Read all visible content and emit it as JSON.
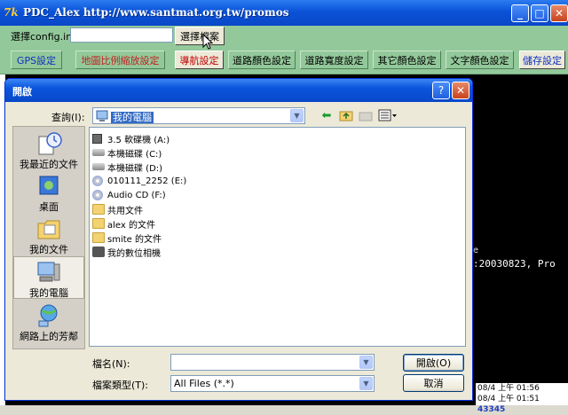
{
  "app": {
    "icon_text": "7k",
    "title": "PDC_Alex http://www.santmat.org.tw/promos"
  },
  "window_controls": {
    "minimize": "_",
    "maximize": "□",
    "close": "✕"
  },
  "toolbar1": {
    "config_label": "選擇config.ini",
    "config_value": "",
    "choose_file_button": "選擇檔案"
  },
  "toolbar2": {
    "buttons": [
      "GPS設定",
      "地圖比例縮放設定",
      "導航設定",
      "道路顏色設定",
      "道路寬度設定",
      "其它顏色設定",
      "文字顏色設定",
      "儲存設定"
    ]
  },
  "terminal": {
    "line1": "e",
    "line2": ":20030823, Pro",
    "status_line1": "08/4 上午 01:56",
    "status_line2": "08/4 上午 01:51",
    "status_selected": "43345"
  },
  "dialog": {
    "title": "開啟",
    "help": "?",
    "close": "✕",
    "look_in_label": "查詢(I):",
    "look_in_value": "我的電腦",
    "places": [
      "我最近的文件",
      "桌面",
      "我的文件",
      "我的電腦",
      "網路上的芳鄰"
    ],
    "files": [
      "3.5 軟碟機 (A:)",
      "本機磁碟 (C:)",
      "本機磁碟 (D:)",
      "010111_2252 (E:)",
      "Audio CD (F:)",
      "共用文件",
      "alex 的文件",
      "smite 的文件",
      "我的數位相機"
    ],
    "filename_label": "檔名(N):",
    "filename_value": "",
    "filetype_label": "檔案類型(T):",
    "filetype_value": "All Files (*.*)",
    "open_button": "開啟(O)",
    "cancel_button": "取消"
  },
  "colors": {
    "titlebar_blue": "#0a55dc",
    "toolbar_green": "#93c99a",
    "terminal_bg": "#000000"
  }
}
